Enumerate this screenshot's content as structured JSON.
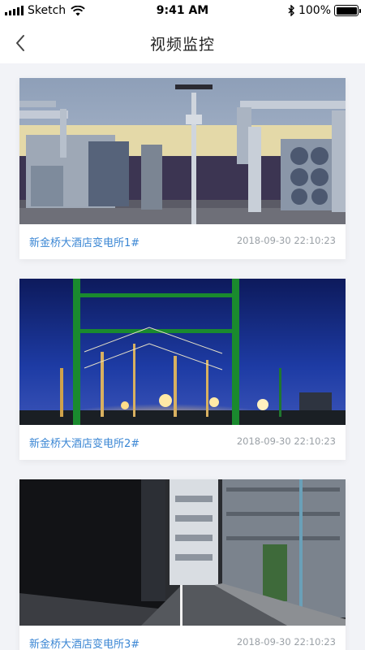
{
  "status_bar": {
    "carrier": "Sketch",
    "time": "9:41 AM",
    "battery_percent": "100%",
    "battery_level": 1.0
  },
  "nav": {
    "title": "视频监控",
    "back_icon": "chevron-left-icon"
  },
  "cameras": [
    {
      "name": "新金桥大酒店变电所1#",
      "timestamp": "2018-09-30 22:10:23"
    },
    {
      "name": "新金桥大酒店变电所2#",
      "timestamp": "2018-09-30 22:10:23"
    },
    {
      "name": "新金桥大酒店变电所3#",
      "timestamp": "2018-09-30 22:10:23"
    }
  ],
  "colors": {
    "accent": "#3a86d4",
    "background": "#f2f3f7",
    "timestamp": "#9aa0a6"
  }
}
